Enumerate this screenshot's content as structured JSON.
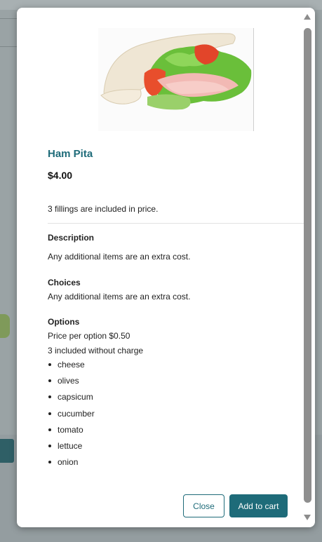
{
  "product": {
    "title": "Ham Pita",
    "price": "$4.00",
    "note": "3 fillings are included in price.",
    "image_alt": "ham pita sandwich"
  },
  "description": {
    "heading": "Description",
    "text": "Any additional items are an extra cost."
  },
  "choices": {
    "heading": "Choices",
    "text": "Any additional items are an extra cost."
  },
  "options": {
    "heading": "Options",
    "price_per_option": "Price per option $0.50",
    "included": "3 included without charge",
    "items": [
      "cheese",
      "olives",
      "capsicum",
      "cucumber",
      "tomato",
      "lettuce",
      "onion"
    ]
  },
  "buttons": {
    "close": "Close",
    "add_to_cart": "Add to cart"
  },
  "colors": {
    "accent": "#1e6b79"
  }
}
